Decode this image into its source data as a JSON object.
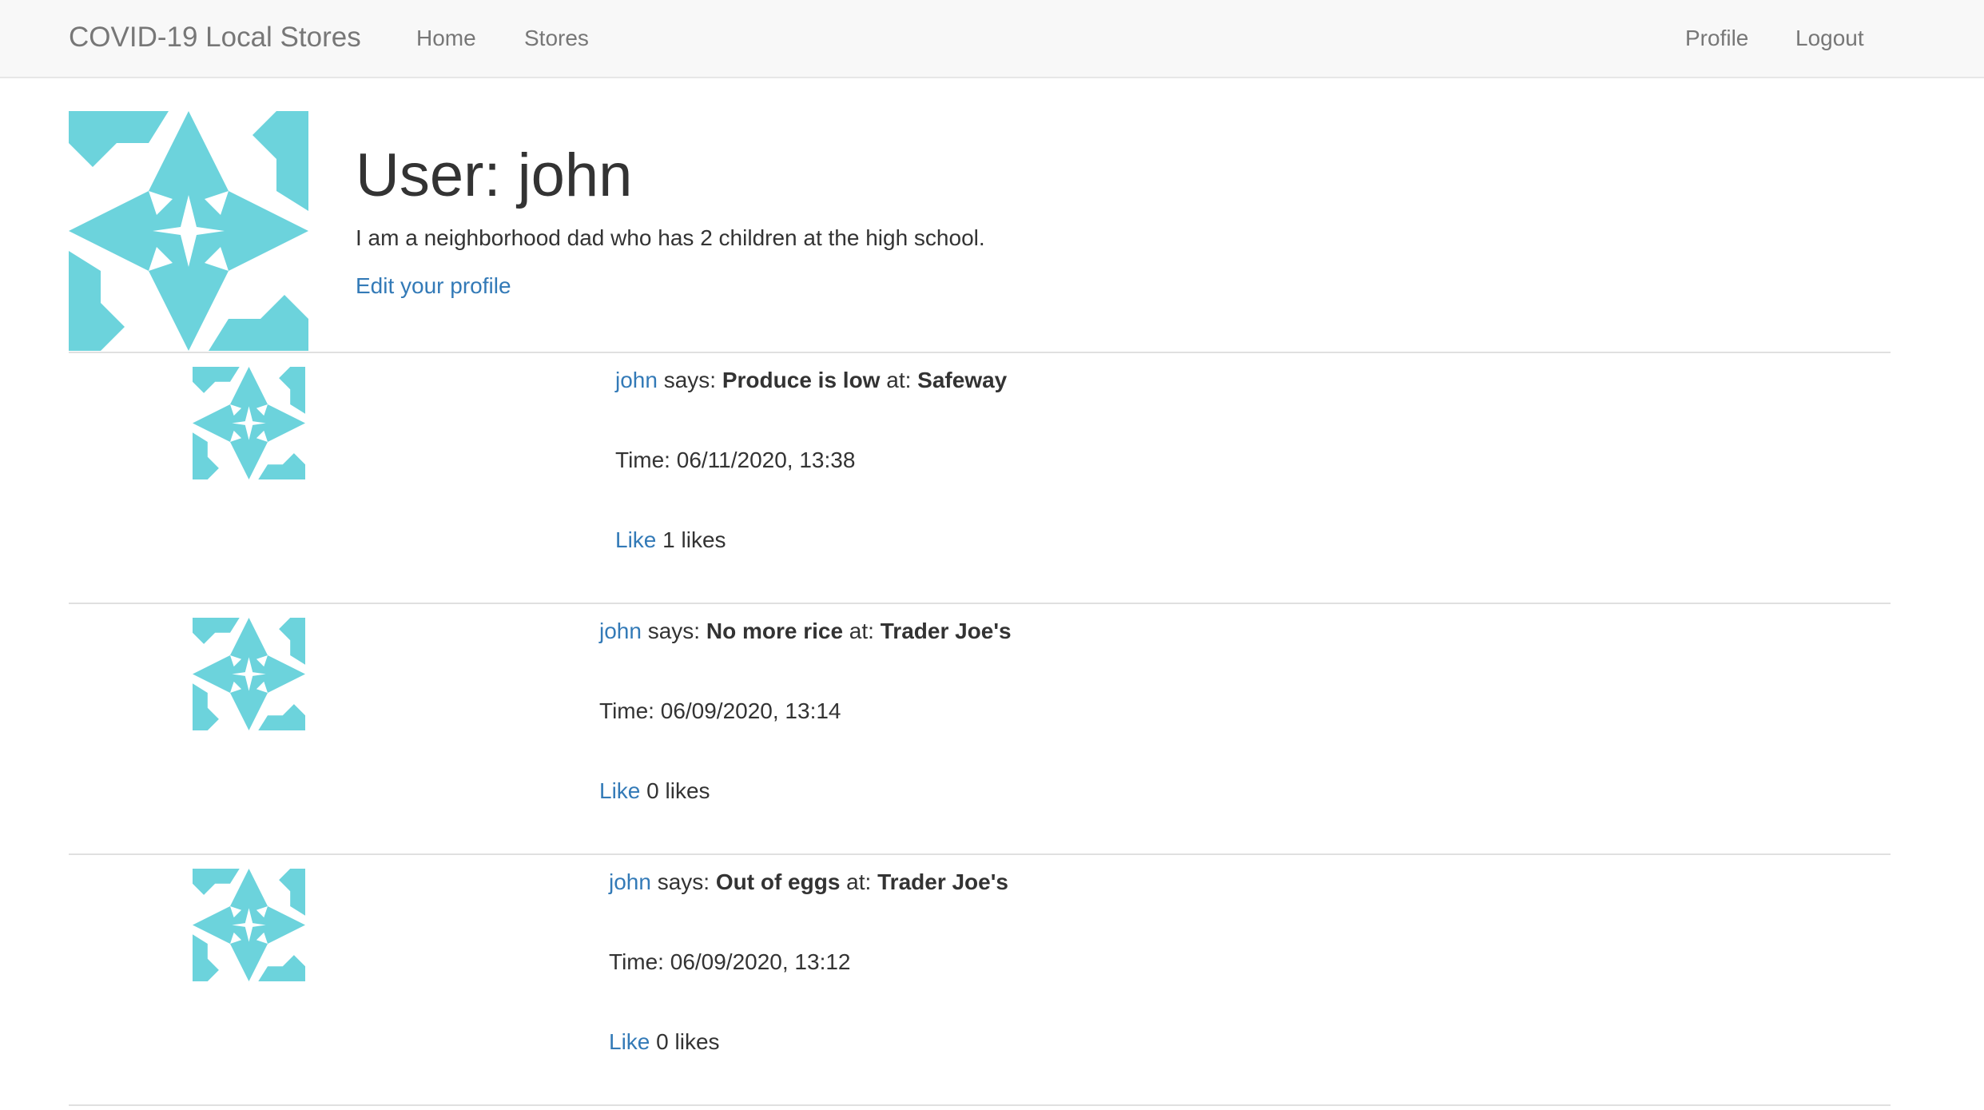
{
  "nav": {
    "brand": "COVID-19 Local Stores",
    "home": "Home",
    "stores": "Stores",
    "profile": "Profile",
    "logout": "Logout"
  },
  "colors": {
    "identicon": "#6cd3dc",
    "link": "#337ab7",
    "navbar_bg": "#f8f8f8"
  },
  "user": {
    "title": "User: john",
    "bio": "I am a neighborhood dad who has 2 children at the high school.",
    "edit_link": "Edit your profile"
  },
  "posts": [
    {
      "author": "john",
      "says": " says: ",
      "message": "Produce is low",
      "at": " at: ",
      "store": "Safeway",
      "time": "Time: 06/11/2020, 13:38",
      "like_label": "Like",
      "likes": " 1 likes"
    },
    {
      "author": "john",
      "says": " says: ",
      "message": "No more rice",
      "at": " at: ",
      "store": "Trader Joe's",
      "time": "Time: 06/09/2020, 13:14",
      "like_label": "Like",
      "likes": " 0 likes"
    },
    {
      "author": "john",
      "says": " says: ",
      "message": "Out of eggs",
      "at": " at: ",
      "store": "Trader Joe's",
      "time": "Time: 06/09/2020, 13:12",
      "like_label": "Like",
      "likes": " 0 likes"
    }
  ]
}
